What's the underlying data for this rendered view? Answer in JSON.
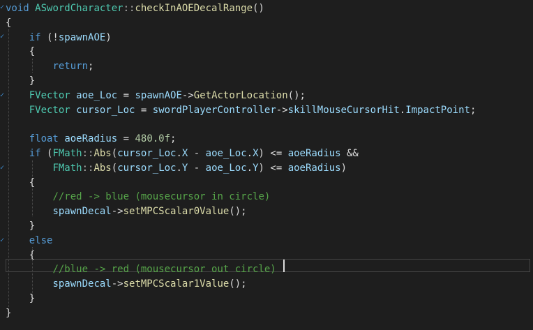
{
  "editor": {
    "lines": [
      [
        [
          "kw",
          "void"
        ],
        [
          "pl",
          " "
        ],
        [
          "typ",
          "ASwordCharacter"
        ],
        [
          "punc",
          "::"
        ],
        [
          "fn",
          "checkInAOEDecalRange"
        ],
        [
          "pl",
          "()"
        ]
      ],
      [
        [
          "pl",
          "{"
        ]
      ],
      [
        [
          "pl",
          "    "
        ],
        [
          "kw",
          "if"
        ],
        [
          "pl",
          " (!"
        ],
        [
          "var",
          "spawnAOE"
        ],
        [
          "pl",
          ")"
        ]
      ],
      [
        [
          "pl",
          "    {"
        ]
      ],
      [
        [
          "pl",
          "        "
        ],
        [
          "kw",
          "return"
        ],
        [
          "pl",
          ";"
        ]
      ],
      [
        [
          "pl",
          "    }"
        ]
      ],
      [
        [
          "pl",
          "    "
        ],
        [
          "typ",
          "FVector"
        ],
        [
          "pl",
          " "
        ],
        [
          "var",
          "aoe_Loc"
        ],
        [
          "pl",
          " = "
        ],
        [
          "var",
          "spawnAOE"
        ],
        [
          "pl",
          "->"
        ],
        [
          "fn",
          "GetActorLocation"
        ],
        [
          "pl",
          "();"
        ]
      ],
      [
        [
          "pl",
          "    "
        ],
        [
          "typ",
          "FVector"
        ],
        [
          "pl",
          " "
        ],
        [
          "var",
          "cursor_Loc"
        ],
        [
          "pl",
          " = "
        ],
        [
          "var",
          "swordPlayerController"
        ],
        [
          "pl",
          "->"
        ],
        [
          "var",
          "skillMouseCursorHit"
        ],
        [
          "pl",
          "."
        ],
        [
          "var",
          "ImpactPoint"
        ],
        [
          "pl",
          ";"
        ]
      ],
      [],
      [
        [
          "pl",
          "    "
        ],
        [
          "kw",
          "float"
        ],
        [
          "pl",
          " "
        ],
        [
          "var",
          "aoeRadius"
        ],
        [
          "pl",
          " = "
        ],
        [
          "num",
          "480.0f"
        ],
        [
          "pl",
          ";"
        ]
      ],
      [
        [
          "pl",
          "    "
        ],
        [
          "kw",
          "if"
        ],
        [
          "pl",
          " ("
        ],
        [
          "typ",
          "FMath"
        ],
        [
          "punc",
          "::"
        ],
        [
          "fn",
          "Abs"
        ],
        [
          "pl",
          "("
        ],
        [
          "var",
          "cursor_Loc"
        ],
        [
          "pl",
          "."
        ],
        [
          "var",
          "X"
        ],
        [
          "pl",
          " - "
        ],
        [
          "var",
          "aoe_Loc"
        ],
        [
          "pl",
          "."
        ],
        [
          "var",
          "X"
        ],
        [
          "pl",
          ") <= "
        ],
        [
          "var",
          "aoeRadius"
        ],
        [
          "pl",
          " &&"
        ]
      ],
      [
        [
          "pl",
          "        "
        ],
        [
          "typ",
          "FMath"
        ],
        [
          "punc",
          "::"
        ],
        [
          "fn",
          "Abs"
        ],
        [
          "pl",
          "("
        ],
        [
          "var",
          "cursor_Loc"
        ],
        [
          "pl",
          "."
        ],
        [
          "var",
          "Y"
        ],
        [
          "pl",
          " - "
        ],
        [
          "var",
          "aoe_Loc"
        ],
        [
          "pl",
          "."
        ],
        [
          "var",
          "Y"
        ],
        [
          "pl",
          ") <= "
        ],
        [
          "var",
          "aoeRadius"
        ],
        [
          "pl",
          ")"
        ]
      ],
      [
        [
          "pl",
          "    {"
        ]
      ],
      [
        [
          "pl",
          "        "
        ],
        [
          "cmt",
          "//red -> blue (mousecursor in circle)"
        ]
      ],
      [
        [
          "pl",
          "        "
        ],
        [
          "var",
          "spawnDecal"
        ],
        [
          "pl",
          "->"
        ],
        [
          "fn",
          "setMPCScalar0Value"
        ],
        [
          "pl",
          "();"
        ]
      ],
      [
        [
          "pl",
          "    }"
        ]
      ],
      [
        [
          "pl",
          "    "
        ],
        [
          "kw",
          "else"
        ]
      ],
      [
        [
          "pl",
          "    {"
        ]
      ],
      [
        [
          "pl",
          "        "
        ],
        [
          "cmt",
          "//blue -> red (mousecursor out circle)"
        ]
      ],
      [
        [
          "pl",
          "        "
        ],
        [
          "var",
          "spawnDecal"
        ],
        [
          "pl",
          "->"
        ],
        [
          "fn",
          "setMPCScalar1Value"
        ],
        [
          "pl",
          "();"
        ]
      ],
      [
        [
          "pl",
          "    }"
        ]
      ],
      [
        [
          "pl",
          "}"
        ]
      ]
    ]
  }
}
